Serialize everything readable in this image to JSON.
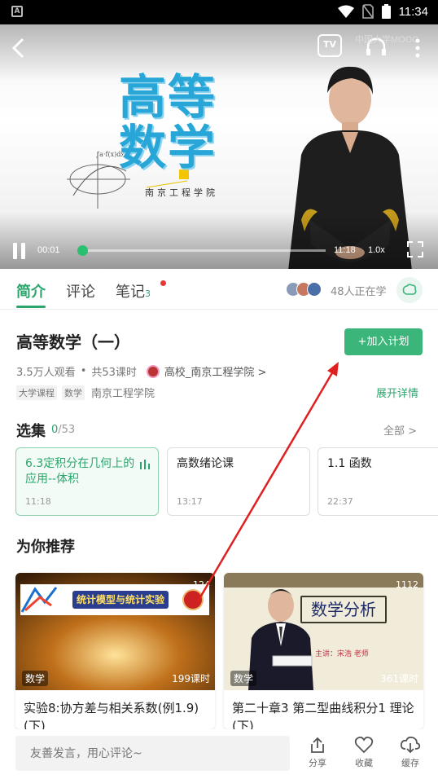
{
  "status_bar": {
    "time": "11:34"
  },
  "video": {
    "title_line1": "高等",
    "title_line2": "数学",
    "school": "南京工程学院",
    "tv_label": "TV",
    "brand": "中国大学MOOC",
    "current_time": "00:01",
    "total_time": "11:18",
    "speed": "1.0x",
    "progress": 0.0
  },
  "tabs": [
    {
      "label": "简介",
      "active": true
    },
    {
      "label": "评论",
      "active": false
    },
    {
      "label": "笔记",
      "count": "3",
      "active": false
    }
  ],
  "learners_text": "48人正在学",
  "course": {
    "title": "高等数学（一）",
    "add_plan_label": "+加入计划",
    "views": "3.5万人观看",
    "separator": "•",
    "lessons": "共53课时",
    "school_link": "高校_南京工程学院 >",
    "tags": [
      "大学课程",
      "数学"
    ],
    "tag_school": "南京工程学院",
    "expand_label": "展开详情"
  },
  "episodes": {
    "title": "选集",
    "progress_done": "0",
    "progress_total": "/53",
    "all_label": "全部  >",
    "items": [
      {
        "title": "6.3定积分在几何上的应用--体积",
        "duration": "11:18",
        "active": true
      },
      {
        "title": "高数绪论课",
        "duration": "13:17",
        "active": false
      },
      {
        "title": "1.1  函数",
        "duration": "22:37",
        "active": false
      }
    ]
  },
  "recommend": {
    "title": "为你推荐",
    "items": [
      {
        "banner": "统计模型与统计实验",
        "count": "124",
        "tag": "数学",
        "lessons": "199课时",
        "title": "实验8:协方差与相关系数(例1.9)(下)"
      },
      {
        "banner": "数学分析",
        "banner_sub": "主讲：宋浩  老师",
        "count": "1112",
        "tag": "数学",
        "lessons": "361课时",
        "title": "第二十章3 第二型曲线积分1 理论(下)"
      }
    ]
  },
  "bottom_bar": {
    "comment_placeholder": "友善发言，用心评论~",
    "share_label": "分享",
    "favorite_label": "收藏",
    "download_label": "缓存"
  },
  "colors": {
    "accent": "#2ca56d",
    "plan_button": "#3bb57a",
    "annotation_arrow": "#e02020"
  }
}
